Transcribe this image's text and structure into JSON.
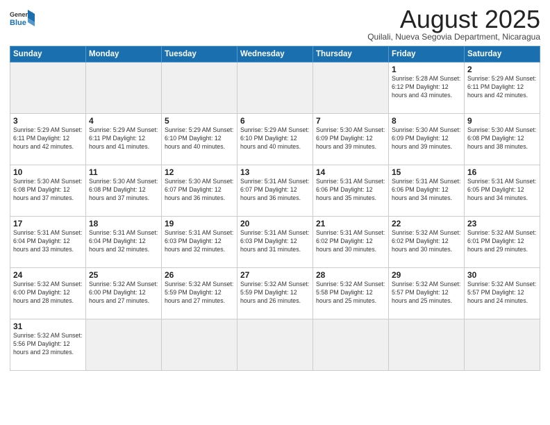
{
  "header": {
    "logo_line1": "General",
    "logo_line2": "Blue",
    "month_title": "August 2025",
    "subtitle": "Quilali, Nueva Segovia Department, Nicaragua"
  },
  "weekdays": [
    "Sunday",
    "Monday",
    "Tuesday",
    "Wednesday",
    "Thursday",
    "Friday",
    "Saturday"
  ],
  "weeks": [
    [
      {
        "day": "",
        "info": ""
      },
      {
        "day": "",
        "info": ""
      },
      {
        "day": "",
        "info": ""
      },
      {
        "day": "",
        "info": ""
      },
      {
        "day": "",
        "info": ""
      },
      {
        "day": "1",
        "info": "Sunrise: 5:28 AM\nSunset: 6:12 PM\nDaylight: 12 hours\nand 43 minutes."
      },
      {
        "day": "2",
        "info": "Sunrise: 5:29 AM\nSunset: 6:11 PM\nDaylight: 12 hours\nand 42 minutes."
      }
    ],
    [
      {
        "day": "3",
        "info": "Sunrise: 5:29 AM\nSunset: 6:11 PM\nDaylight: 12 hours\nand 42 minutes."
      },
      {
        "day": "4",
        "info": "Sunrise: 5:29 AM\nSunset: 6:11 PM\nDaylight: 12 hours\nand 41 minutes."
      },
      {
        "day": "5",
        "info": "Sunrise: 5:29 AM\nSunset: 6:10 PM\nDaylight: 12 hours\nand 40 minutes."
      },
      {
        "day": "6",
        "info": "Sunrise: 5:29 AM\nSunset: 6:10 PM\nDaylight: 12 hours\nand 40 minutes."
      },
      {
        "day": "7",
        "info": "Sunrise: 5:30 AM\nSunset: 6:09 PM\nDaylight: 12 hours\nand 39 minutes."
      },
      {
        "day": "8",
        "info": "Sunrise: 5:30 AM\nSunset: 6:09 PM\nDaylight: 12 hours\nand 39 minutes."
      },
      {
        "day": "9",
        "info": "Sunrise: 5:30 AM\nSunset: 6:08 PM\nDaylight: 12 hours\nand 38 minutes."
      }
    ],
    [
      {
        "day": "10",
        "info": "Sunrise: 5:30 AM\nSunset: 6:08 PM\nDaylight: 12 hours\nand 37 minutes."
      },
      {
        "day": "11",
        "info": "Sunrise: 5:30 AM\nSunset: 6:08 PM\nDaylight: 12 hours\nand 37 minutes."
      },
      {
        "day": "12",
        "info": "Sunrise: 5:30 AM\nSunset: 6:07 PM\nDaylight: 12 hours\nand 36 minutes."
      },
      {
        "day": "13",
        "info": "Sunrise: 5:31 AM\nSunset: 6:07 PM\nDaylight: 12 hours\nand 36 minutes."
      },
      {
        "day": "14",
        "info": "Sunrise: 5:31 AM\nSunset: 6:06 PM\nDaylight: 12 hours\nand 35 minutes."
      },
      {
        "day": "15",
        "info": "Sunrise: 5:31 AM\nSunset: 6:06 PM\nDaylight: 12 hours\nand 34 minutes."
      },
      {
        "day": "16",
        "info": "Sunrise: 5:31 AM\nSunset: 6:05 PM\nDaylight: 12 hours\nand 34 minutes."
      }
    ],
    [
      {
        "day": "17",
        "info": "Sunrise: 5:31 AM\nSunset: 6:04 PM\nDaylight: 12 hours\nand 33 minutes."
      },
      {
        "day": "18",
        "info": "Sunrise: 5:31 AM\nSunset: 6:04 PM\nDaylight: 12 hours\nand 32 minutes."
      },
      {
        "day": "19",
        "info": "Sunrise: 5:31 AM\nSunset: 6:03 PM\nDaylight: 12 hours\nand 32 minutes."
      },
      {
        "day": "20",
        "info": "Sunrise: 5:31 AM\nSunset: 6:03 PM\nDaylight: 12 hours\nand 31 minutes."
      },
      {
        "day": "21",
        "info": "Sunrise: 5:31 AM\nSunset: 6:02 PM\nDaylight: 12 hours\nand 30 minutes."
      },
      {
        "day": "22",
        "info": "Sunrise: 5:32 AM\nSunset: 6:02 PM\nDaylight: 12 hours\nand 30 minutes."
      },
      {
        "day": "23",
        "info": "Sunrise: 5:32 AM\nSunset: 6:01 PM\nDaylight: 12 hours\nand 29 minutes."
      }
    ],
    [
      {
        "day": "24",
        "info": "Sunrise: 5:32 AM\nSunset: 6:00 PM\nDaylight: 12 hours\nand 28 minutes."
      },
      {
        "day": "25",
        "info": "Sunrise: 5:32 AM\nSunset: 6:00 PM\nDaylight: 12 hours\nand 27 minutes."
      },
      {
        "day": "26",
        "info": "Sunrise: 5:32 AM\nSunset: 5:59 PM\nDaylight: 12 hours\nand 27 minutes."
      },
      {
        "day": "27",
        "info": "Sunrise: 5:32 AM\nSunset: 5:59 PM\nDaylight: 12 hours\nand 26 minutes."
      },
      {
        "day": "28",
        "info": "Sunrise: 5:32 AM\nSunset: 5:58 PM\nDaylight: 12 hours\nand 25 minutes."
      },
      {
        "day": "29",
        "info": "Sunrise: 5:32 AM\nSunset: 5:57 PM\nDaylight: 12 hours\nand 25 minutes."
      },
      {
        "day": "30",
        "info": "Sunrise: 5:32 AM\nSunset: 5:57 PM\nDaylight: 12 hours\nand 24 minutes."
      }
    ],
    [
      {
        "day": "31",
        "info": "Sunrise: 5:32 AM\nSunset: 5:56 PM\nDaylight: 12 hours\nand 23 minutes."
      },
      {
        "day": "",
        "info": ""
      },
      {
        "day": "",
        "info": ""
      },
      {
        "day": "",
        "info": ""
      },
      {
        "day": "",
        "info": ""
      },
      {
        "day": "",
        "info": ""
      },
      {
        "day": "",
        "info": ""
      }
    ]
  ]
}
